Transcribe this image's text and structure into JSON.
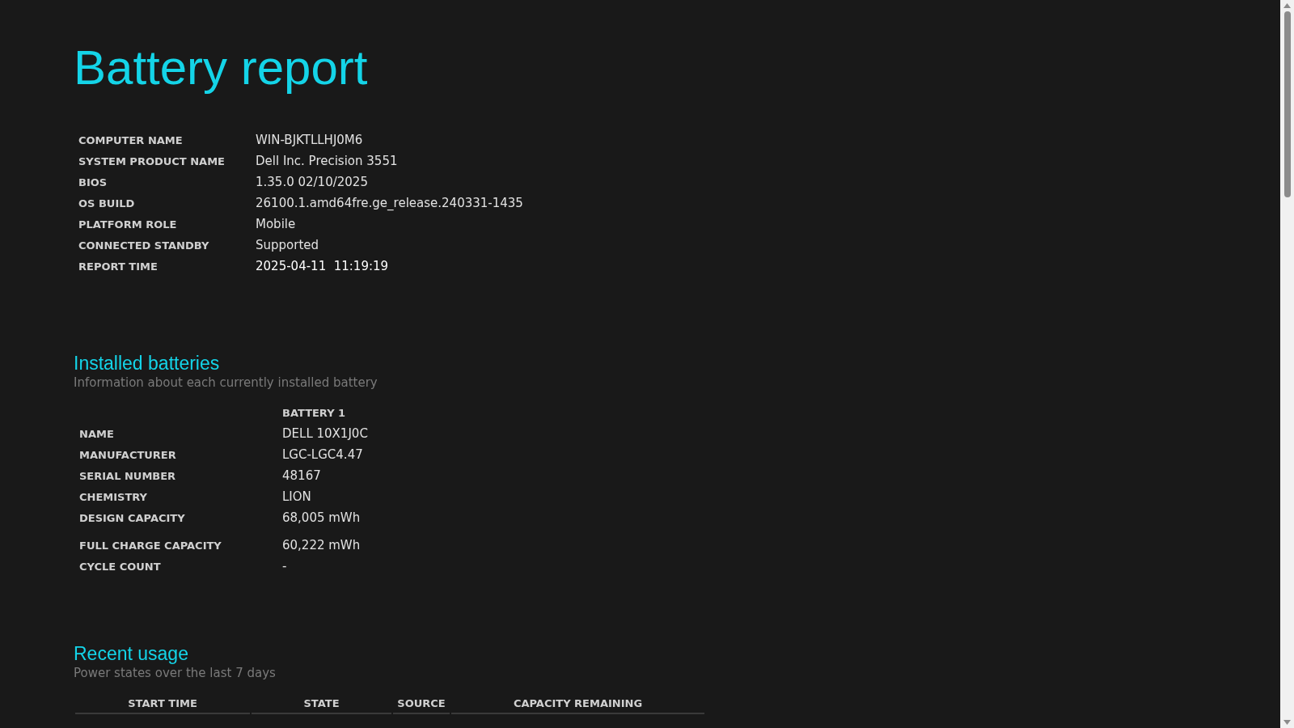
{
  "title": "Battery report",
  "system_info": [
    {
      "label": "COMPUTER NAME",
      "value": "WIN-BJKTLLHJ0M6"
    },
    {
      "label": "SYSTEM PRODUCT NAME",
      "value": "Dell Inc. Precision 3551"
    },
    {
      "label": "BIOS",
      "value": "1.35.0 02/10/2025"
    },
    {
      "label": "OS BUILD",
      "value": "26100.1.amd64fre.ge_release.240331-1435"
    },
    {
      "label": "PLATFORM ROLE",
      "value": "Mobile"
    },
    {
      "label": "CONNECTED STANDBY",
      "value": "Supported"
    },
    {
      "label": "REPORT TIME",
      "value": "2025-04-11  11:19:19"
    }
  ],
  "installed_batteries": {
    "heading": "Installed batteries",
    "subtitle": "Information about each currently installed battery",
    "column_header": "BATTERY 1",
    "rows": [
      {
        "label": "NAME",
        "value": "DELL 10X1J0C"
      },
      {
        "label": "MANUFACTURER",
        "value": "LGC-LGC4.47"
      },
      {
        "label": "SERIAL NUMBER",
        "value": "48167"
      },
      {
        "label": "CHEMISTRY",
        "value": "LION"
      },
      {
        "label": "DESIGN CAPACITY",
        "value": "68,005 mWh"
      },
      {
        "label": "FULL CHARGE CAPACITY",
        "value": "60,222 mWh"
      },
      {
        "label": "CYCLE COUNT",
        "value": "-"
      }
    ]
  },
  "recent_usage": {
    "heading": "Recent usage",
    "subtitle": "Power states over the last 7 days",
    "columns": [
      "START TIME",
      "STATE",
      "SOURCE",
      "CAPACITY REMAINING"
    ]
  }
}
